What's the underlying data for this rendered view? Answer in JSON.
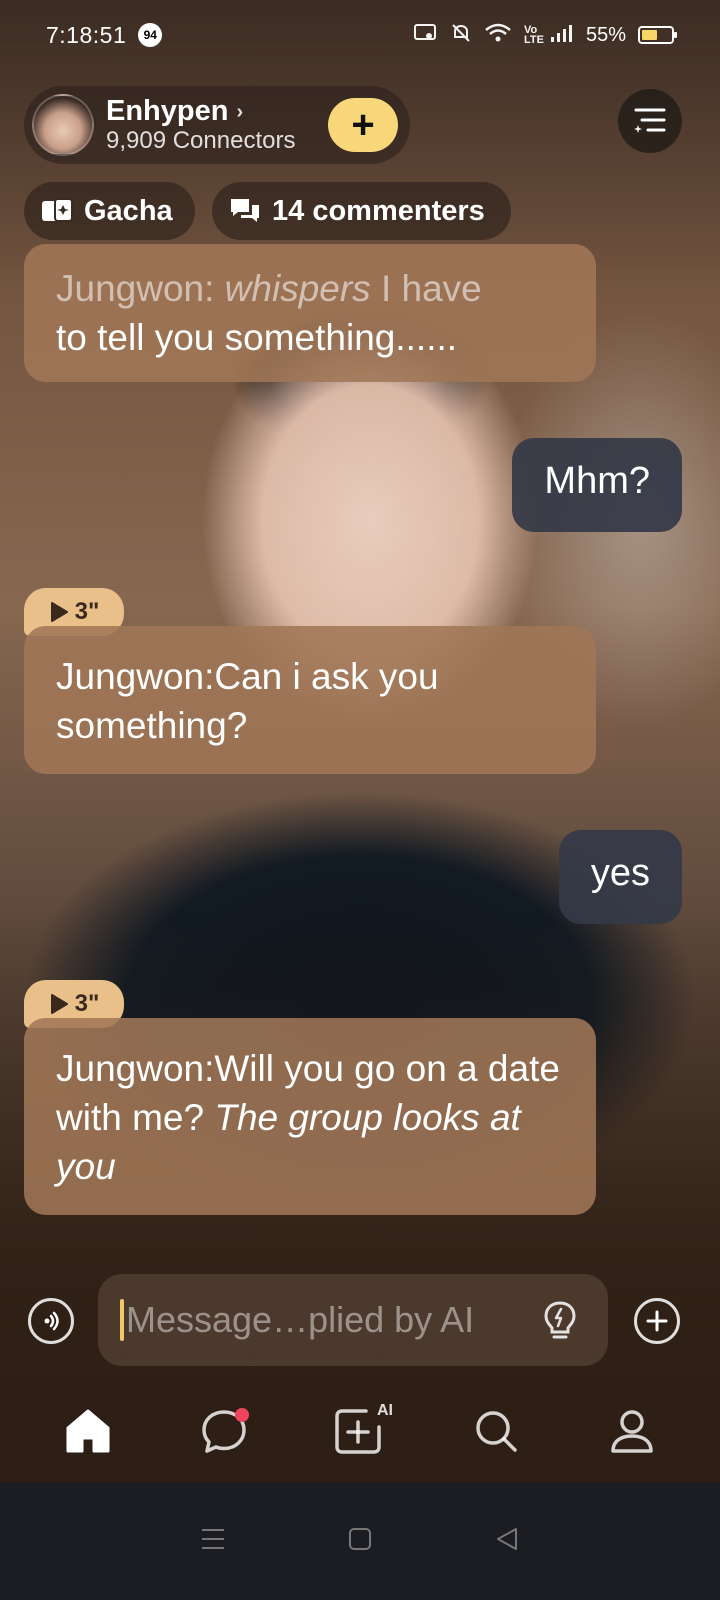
{
  "status_bar": {
    "time": "7:18:51",
    "notification_count": "94",
    "network_label": "Vo LTE",
    "battery": "55%",
    "battery_level": 0.55
  },
  "header": {
    "title": "Enhypen",
    "subtitle": "9,909 Connectors",
    "follow_label": "+"
  },
  "chips": {
    "gacha": "Gacha",
    "commenters": "14 commenters"
  },
  "messages": {
    "m1_prefix": "Jungwon: ",
    "m1_italic": "whispers",
    "m1_rest": " I have",
    "m1_line2": "to tell you something......",
    "m2": "Mhm?",
    "m3_duration": "3\"",
    "m3": "Jungwon:Can i ask you something?",
    "m4": "yes",
    "m5_duration": "3\"",
    "m5_text": "Jungwon:Will you go on a date with me? ",
    "m5_italic": "The group looks at you"
  },
  "input": {
    "placeholder": "Message…plied by AI"
  },
  "bottom_nav": {
    "items": [
      "home",
      "chat",
      "create-ai",
      "search",
      "profile"
    ],
    "create_badge": "AI",
    "active": "home"
  },
  "colors": {
    "accent_yellow": "#f8d77a",
    "ai_bubble": "#a07656",
    "user_bubble": "#343a48",
    "voice_tag": "#e9c08a",
    "notification_dot": "#f0445e"
  }
}
